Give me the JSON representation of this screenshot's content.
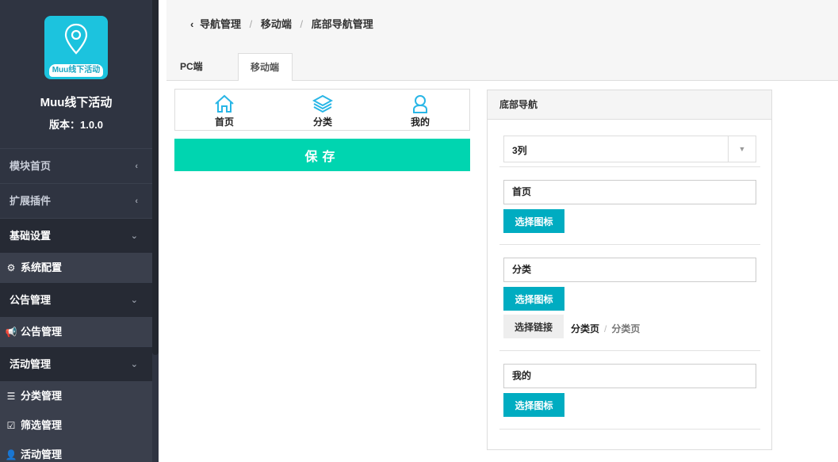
{
  "sidebar": {
    "logo_text": "Muu线下活动",
    "app_name": "Muu线下活动",
    "version": "版本：1.0.0",
    "groups": [
      {
        "label": "模块首页"
      },
      {
        "label": "扩展插件"
      },
      {
        "label": "基础设置"
      },
      {
        "label": "公告管理"
      },
      {
        "label": "活动管理"
      }
    ],
    "subs": [
      {
        "label": "系统配置",
        "icon": "cogs-icon"
      },
      {
        "label": "公告管理",
        "icon": "bullhorn-icon"
      },
      {
        "label": "分类管理",
        "icon": "list-icon"
      },
      {
        "label": "筛选管理",
        "icon": "check-square-icon"
      },
      {
        "label": "活动管理",
        "icon": "user-plus-icon"
      }
    ]
  },
  "breadcrumb": {
    "items": [
      "导航管理",
      "移动端",
      "底部导航管理"
    ]
  },
  "tabs": [
    {
      "label": "PC端",
      "active": false
    },
    {
      "label": "移动端",
      "active": true
    }
  ],
  "preview": {
    "items": [
      {
        "label": "首页",
        "icon": "home-icon"
      },
      {
        "label": "分类",
        "icon": "layers-icon"
      },
      {
        "label": "我的",
        "icon": "user-icon"
      }
    ],
    "save_label": "保存"
  },
  "panel": {
    "title": "底部导航",
    "columns_value": "3列",
    "navs": [
      {
        "name": "首页",
        "icon_button": "选择图标"
      },
      {
        "name": "分类",
        "icon_button": "选择图标",
        "link_button": "选择链接",
        "link_path": [
          "分类页",
          "分类页"
        ]
      },
      {
        "name": "我的",
        "icon_button": "选择图标"
      }
    ]
  },
  "colors": {
    "sidebar_bg": "#2f3441",
    "accent_teal": "#00d5b0",
    "button_cyan": "#00acc1",
    "logo_blue": "#1cc3de",
    "preview_icon": "#29b6e6"
  }
}
